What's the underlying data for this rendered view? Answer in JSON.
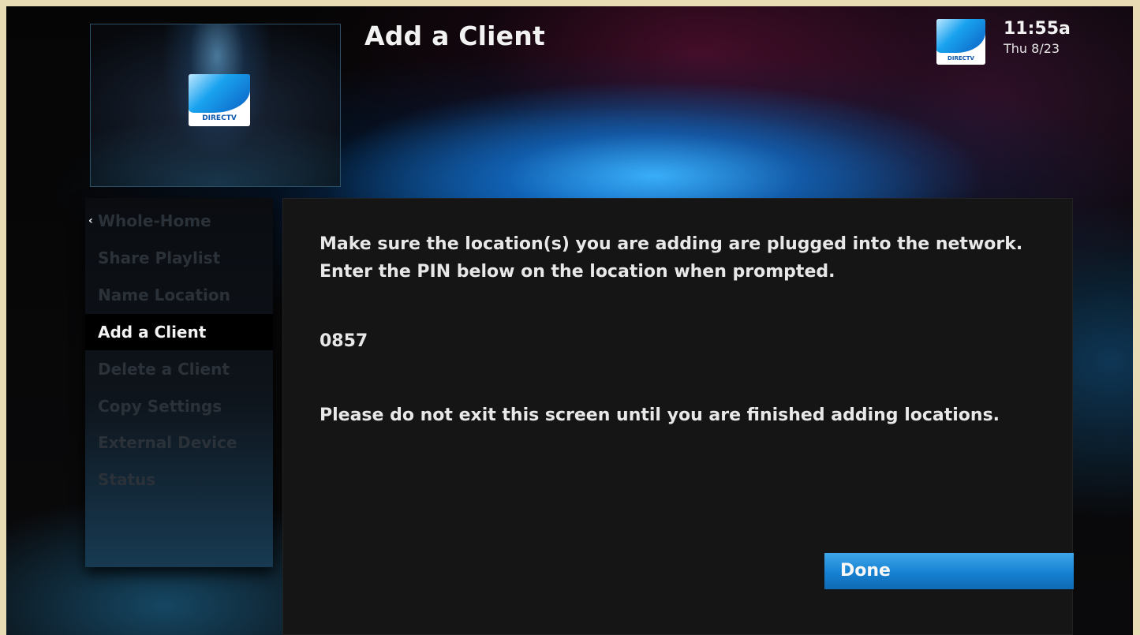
{
  "header": {
    "title": "Add a Client",
    "time": "11:55a",
    "date": "Thu 8/23",
    "logo_text": "DIRECTV"
  },
  "preview": {
    "logo_text": "DIRECTV"
  },
  "sidebar": {
    "items": [
      {
        "label": "Whole-Home",
        "state": "parent"
      },
      {
        "label": "Share Playlist",
        "state": "inactive"
      },
      {
        "label": "Name Location",
        "state": "inactive"
      },
      {
        "label": "Add a Client",
        "state": "selected"
      },
      {
        "label": "Delete a Client",
        "state": "inactive"
      },
      {
        "label": "Copy Settings",
        "state": "inactive"
      },
      {
        "label": "External Device",
        "state": "inactive"
      },
      {
        "label": "Status",
        "state": "inactive"
      }
    ],
    "back_arrow": "‹"
  },
  "content": {
    "instruction": "Make sure the location(s) you are adding are plugged into the network. Enter the PIN below on the location when prompted.",
    "pin": "0857",
    "warning": "Please do not exit this screen until you are finished adding locations.",
    "done_label": "Done"
  },
  "colors": {
    "accent_blue": "#1681d1",
    "selected_bg": "#000000",
    "inactive_text": "#2b3138"
  }
}
